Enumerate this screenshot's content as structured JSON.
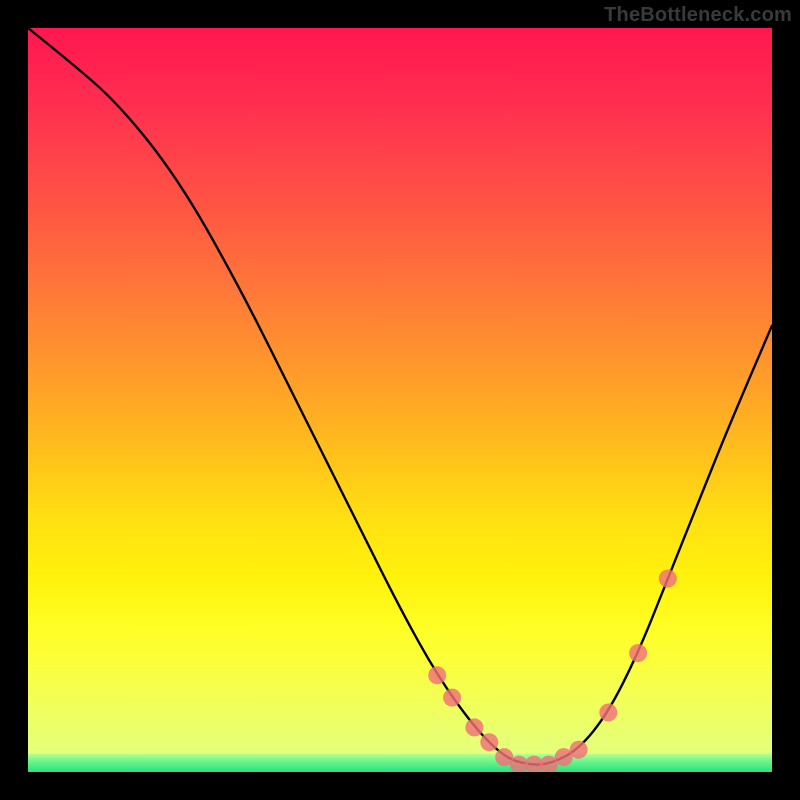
{
  "watermark": "TheBottleneck.com",
  "chart_data": {
    "type": "line",
    "title": "",
    "xlabel": "",
    "ylabel": "",
    "xlim": [
      0,
      100
    ],
    "ylim": [
      0,
      100
    ],
    "series": [
      {
        "name": "bottleneck-curve",
        "x": [
          0,
          5,
          12,
          20,
          28,
          36,
          44,
          50,
          55,
          60,
          64,
          67,
          70,
          74,
          78,
          82,
          86,
          90,
          94,
          100
        ],
        "values": [
          100,
          96,
          90,
          80,
          66,
          50,
          34,
          22,
          13,
          6,
          2,
          1,
          1,
          3,
          8,
          16,
          26,
          36,
          46,
          60
        ]
      }
    ],
    "markers": {
      "name": "highlight-dots",
      "color": "#f07078",
      "x": [
        55,
        57,
        60,
        62,
        64,
        66,
        68,
        70,
        72,
        74,
        78,
        82,
        86
      ],
      "values": [
        13,
        10,
        6,
        4,
        2,
        1,
        1,
        1,
        2,
        3,
        8,
        16,
        26
      ]
    },
    "colors": {
      "curve": "#000000",
      "markers": "#f07078",
      "background_top": "#ff1750",
      "background_bottom": "#28e07f"
    }
  }
}
